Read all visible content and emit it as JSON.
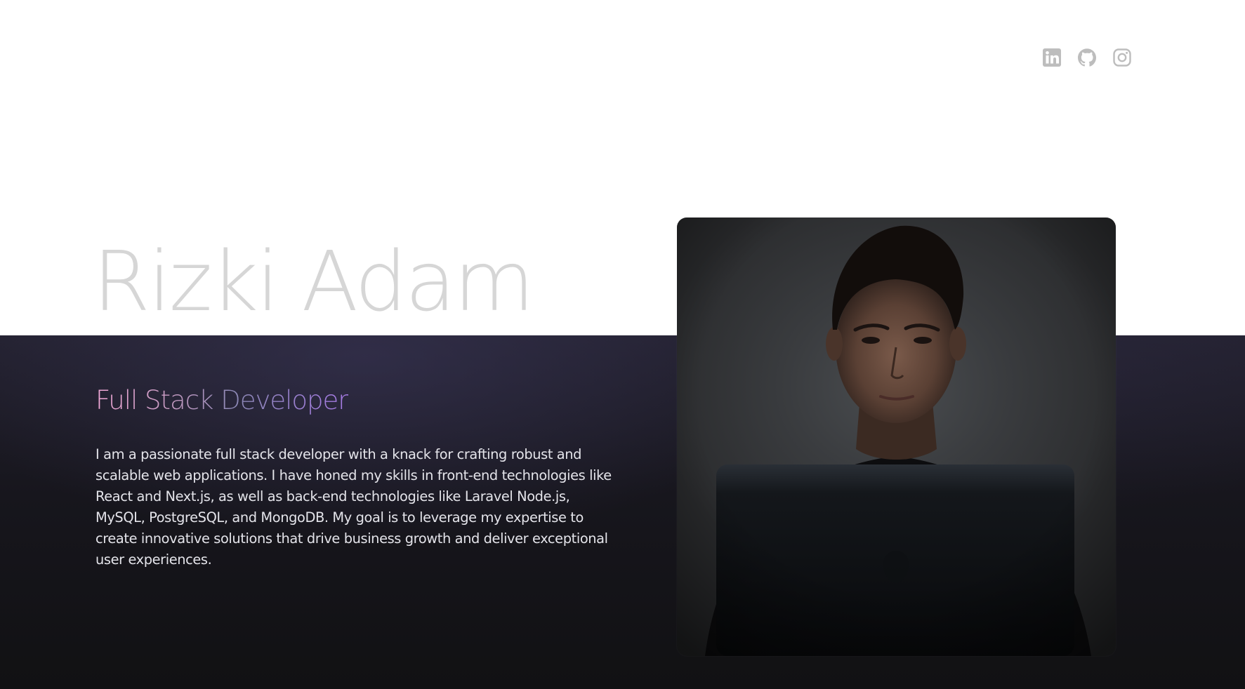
{
  "header": {
    "socials": [
      {
        "icon": "linkedin-icon",
        "label": "LinkedIn"
      },
      {
        "icon": "github-icon",
        "label": "GitHub"
      },
      {
        "icon": "instagram-icon",
        "label": "Instagram"
      }
    ]
  },
  "hero": {
    "name": "Rizki Adam",
    "role": "Full Stack Developer",
    "bio": "I am a passionate full stack developer with a knack for crafting robust and scalable web applications. I have honed my skills in front-end technologies like React and Next.js, as well as back-end technologies like Laravel Node.js, MySQL, PostgreSQL, and MongoDB. My goal is to leverage my expertise to create innovative solutions that drive business growth and deliver exceptional user experiences."
  },
  "colors": {
    "background_top": "#ffffff",
    "background_bottom": "#1a1922",
    "name_text": "#d6d6d6",
    "role_gradient_start": "#f2a9d8",
    "role_gradient_end": "#a77be6",
    "bio_text": "#e4e4ea",
    "icon_gray": "#bdbdbd"
  }
}
